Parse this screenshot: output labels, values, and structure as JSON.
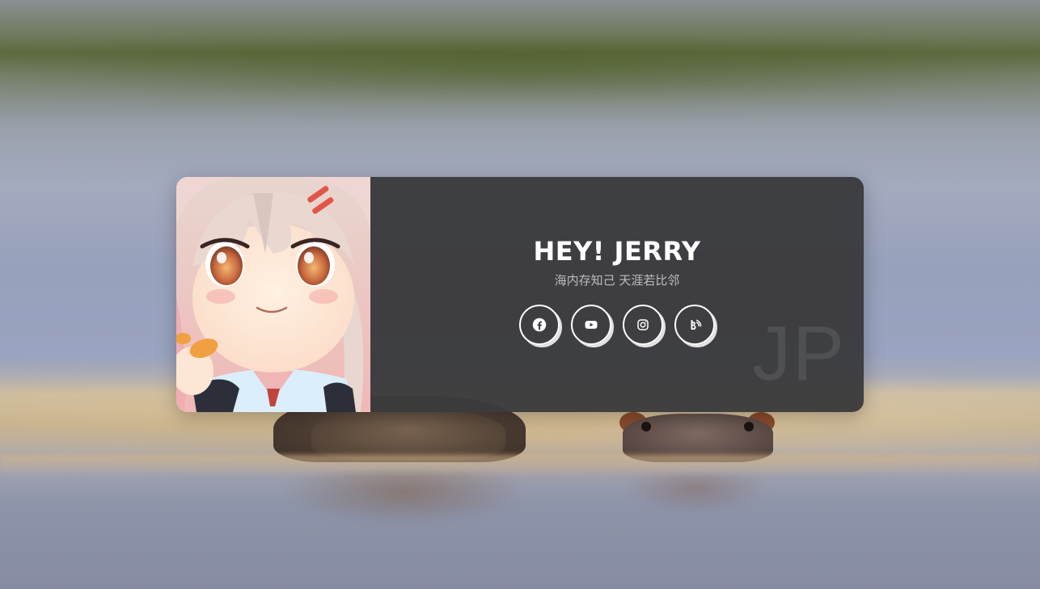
{
  "page": {
    "background_description_colors": {
      "water": "#9aa3bf",
      "shore": "#5e6a3f",
      "glare": "#d8c3a0"
    }
  },
  "card": {
    "title": "HEY! JERRY",
    "subtitle": "海内存知己 天涯若比邻",
    "watermark": "JP",
    "panel_color": "#3a3a3c",
    "text_color": "#ffffff",
    "subtitle_color": "#bdbdbd"
  },
  "social": [
    {
      "icon": "facebook-icon"
    },
    {
      "icon": "youtube-icon"
    },
    {
      "icon": "instagram-icon"
    },
    {
      "icon": "bilibili-icon"
    }
  ]
}
